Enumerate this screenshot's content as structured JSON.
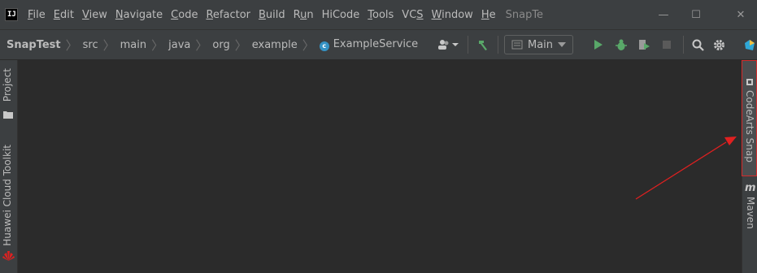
{
  "menubar": {
    "logo": "IJ",
    "items": [
      {
        "label": "File",
        "mnemonic_index": 0
      },
      {
        "label": "Edit",
        "mnemonic_index": 0
      },
      {
        "label": "View",
        "mnemonic_index": 0
      },
      {
        "label": "Navigate",
        "mnemonic_index": 0
      },
      {
        "label": "Code",
        "mnemonic_index": 0
      },
      {
        "label": "Refactor",
        "mnemonic_index": 0
      },
      {
        "label": "Build",
        "mnemonic_index": 0
      },
      {
        "label": "Run",
        "mnemonic_index": 1
      },
      {
        "label": "HiCode",
        "mnemonic_index": -1
      },
      {
        "label": "Tools",
        "mnemonic_index": 0
      },
      {
        "label": "VCS",
        "mnemonic_index": 2
      },
      {
        "label": "Window",
        "mnemonic_index": 0
      },
      {
        "label": "He",
        "mnemonic_index": 0
      }
    ],
    "window_title": "SnapTe",
    "controls": {
      "minimize": "—",
      "maximize": "☐",
      "close": "✕"
    }
  },
  "breadcrumb": {
    "items": [
      "SnapTest",
      "src",
      "main",
      "java",
      "org",
      "example",
      "ExampleService"
    ],
    "class_icon": "class-icon"
  },
  "toolbar": {
    "run_config": "Main",
    "colors": {
      "run": "#59a869",
      "debug": "#59a869",
      "stop": "#6e6e6e",
      "hammer": "#59a869"
    }
  },
  "left_tools": {
    "project": "Project",
    "huawei": "Huawei Cloud Toolkit"
  },
  "right_tools": {
    "snap": "CodeArts Snap",
    "maven": "Maven"
  },
  "annotation": {
    "highlight_color": "#d52b2b",
    "arrow_color": "#e02020"
  }
}
